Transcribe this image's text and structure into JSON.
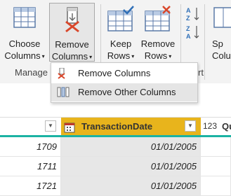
{
  "ribbon": {
    "choose_columns": {
      "line1": "Choose",
      "line2": "Columns",
      "icon": "choose-columns-icon"
    },
    "remove_columns": {
      "line1": "Remove",
      "line2": "Columns",
      "icon": "remove-columns-icon"
    },
    "keep_rows": {
      "line1": "Keep",
      "line2": "Rows",
      "icon": "keep-rows-icon"
    },
    "remove_rows": {
      "line1": "Remove",
      "line2": "Rows",
      "icon": "remove-rows-icon"
    },
    "sort_ascending_icon": "sort-ascending-icon",
    "sort_descending_icon": "sort-descending-icon",
    "split_partial": {
      "line1": "Sp",
      "line2": "Colu"
    },
    "group_manage": "Manage",
    "group_sort_partial": "rt",
    "caret": "▾"
  },
  "dropdown": {
    "items": [
      {
        "label": "Remove Columns",
        "icon": "remove-columns-icon"
      },
      {
        "label": "Remove Other Columns",
        "icon": "remove-other-columns-icon",
        "highlighted": true
      }
    ]
  },
  "grid": {
    "columns": [
      {
        "label": "",
        "type_icon": "",
        "selected": false
      },
      {
        "label": "TransactionDate",
        "type_icon": "date-type-icon",
        "selected": true
      },
      {
        "label": "Qu",
        "type_icon": "123",
        "selected": false
      }
    ],
    "rows": [
      [
        "1709",
        "01/01/2005"
      ],
      [
        "1711",
        "01/01/2005"
      ],
      [
        "1721",
        "01/01/2005"
      ]
    ],
    "accent": "#1bb3a3",
    "selected_header_color": "#e8b41c"
  }
}
